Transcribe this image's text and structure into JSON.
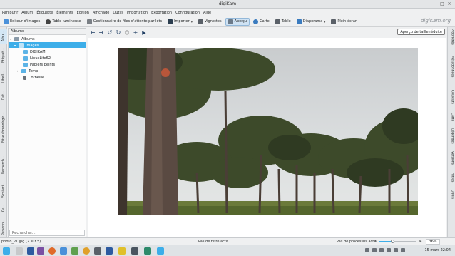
{
  "window": {
    "title": "digiKam"
  },
  "menu": [
    "Parcourir",
    "Album",
    "Étiquette",
    "Éléments",
    "Édition",
    "Affichage",
    "Outils",
    "Importation",
    "Exportation",
    "Configuration",
    "Aide"
  ],
  "toolbar": {
    "image_editor": "Éditeur d'images",
    "light_table": "Table lumineuse",
    "batch_queue": "Gestionnaire de files d'attente par lots",
    "import": "Importer",
    "thumbnails": "Vignettes",
    "preview": "Aperçu",
    "map": "Carte",
    "table": "Table",
    "slideshow": "Diaporama",
    "fullscreen": "Plein écran"
  },
  "logo": "digiKam.org",
  "left_tabs": [
    "Albu...",
    "Étiquet...",
    "Libell...",
    "Dat...",
    "Frise chronologiq...",
    "Recherch...",
    "Similari...",
    "Ca...",
    "Personn..."
  ],
  "right_tabs": [
    "Propriétés",
    "Métadonnées",
    "Couleurs",
    "Carte",
    "Légendes",
    "Versions",
    "Filtres",
    "Outils"
  ],
  "albums_panel": {
    "header": "Albums",
    "items": [
      {
        "label": "Albums",
        "level": 0,
        "expanded": true
      },
      {
        "label": "Images",
        "level": 1,
        "expanded": true,
        "selected": true
      },
      {
        "label": "DIGIKAM",
        "level": 2
      },
      {
        "label": "LinuxLite62",
        "level": 2
      },
      {
        "label": "Papiers peints",
        "level": 2
      },
      {
        "label": "Temp",
        "level": 2,
        "collapsed": true
      },
      {
        "label": "Corbeille",
        "level": 2,
        "trash": true
      }
    ],
    "search_placeholder": "Rechercher..."
  },
  "viewer": {
    "reduced_preview_label": "Aperçu de taille réduite"
  },
  "statusbar": {
    "file": "photo_v1.jpg (2 sur 5)",
    "filter": "Pas de filtre actif",
    "process": "Pas de processus actif",
    "zoom_percent": "36%",
    "zoom_value": 0.36
  },
  "taskbar": {
    "clock": "15 mars  22:04"
  },
  "colors": {
    "accent": "#3daee9",
    "folder": "#5cb3e6"
  }
}
